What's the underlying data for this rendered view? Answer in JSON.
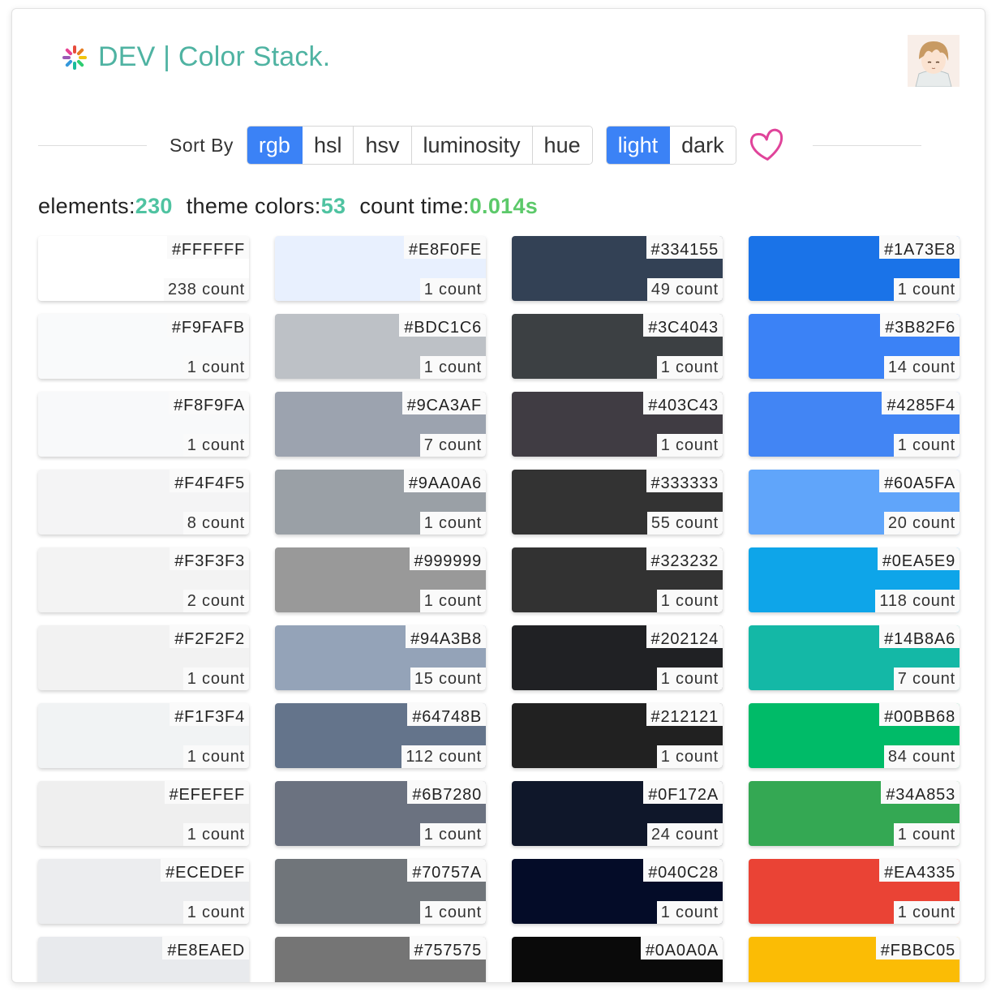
{
  "header": {
    "title": "DEV | Color Stack.",
    "logo_icon": "pinwheel-logo-icon",
    "avatar_icon": "anime-avatar-icon"
  },
  "toolbar": {
    "sort_label": "Sort By",
    "sort_options": [
      "rgb",
      "hsl",
      "hsv",
      "luminosity",
      "hue"
    ],
    "sort_selected": "rgb",
    "theme_options": [
      "light",
      "dark"
    ],
    "theme_selected": "light",
    "like_icon": "heart-icon",
    "accent_color": "#3b82f6"
  },
  "stats": {
    "elements_label": "elements:",
    "elements_value": "230",
    "theme_colors_label": "theme colors:",
    "theme_colors_value": "53",
    "count_time_label": "count time:",
    "count_time_value": "0.014s"
  },
  "columns": [
    [
      {
        "hex": "#FFFFFF",
        "count": "238 count"
      },
      {
        "hex": "#F9FAFB",
        "count": "1 count"
      },
      {
        "hex": "#F8F9FA",
        "count": "1 count"
      },
      {
        "hex": "#F4F4F5",
        "count": "8 count"
      },
      {
        "hex": "#F3F3F3",
        "count": "2 count"
      },
      {
        "hex": "#F2F2F2",
        "count": "1 count"
      },
      {
        "hex": "#F1F3F4",
        "count": "1 count"
      },
      {
        "hex": "#EFEFEF",
        "count": "1 count"
      },
      {
        "hex": "#ECEDEF",
        "count": "1 count"
      },
      {
        "hex": "#E8EAED",
        "count": ""
      }
    ],
    [
      {
        "hex": "#E8F0FE",
        "count": "1 count"
      },
      {
        "hex": "#BDC1C6",
        "count": "1 count"
      },
      {
        "hex": "#9CA3AF",
        "count": "7 count"
      },
      {
        "hex": "#9AA0A6",
        "count": "1 count"
      },
      {
        "hex": "#999999",
        "count": "1 count"
      },
      {
        "hex": "#94A3B8",
        "count": "15 count"
      },
      {
        "hex": "#64748B",
        "count": "112 count"
      },
      {
        "hex": "#6B7280",
        "count": "1 count"
      },
      {
        "hex": "#70757A",
        "count": "1 count"
      },
      {
        "hex": "#757575",
        "count": ""
      }
    ],
    [
      {
        "hex": "#334155",
        "count": "49 count"
      },
      {
        "hex": "#3C4043",
        "count": "1 count"
      },
      {
        "hex": "#403C43",
        "count": "1 count"
      },
      {
        "hex": "#333333",
        "count": "55 count"
      },
      {
        "hex": "#323232",
        "count": "1 count"
      },
      {
        "hex": "#202124",
        "count": "1 count"
      },
      {
        "hex": "#212121",
        "count": "1 count"
      },
      {
        "hex": "#0F172A",
        "count": "24 count"
      },
      {
        "hex": "#040C28",
        "count": "1 count"
      },
      {
        "hex": "#0A0A0A",
        "count": ""
      }
    ],
    [
      {
        "hex": "#1A73E8",
        "count": "1 count"
      },
      {
        "hex": "#3B82F6",
        "count": "14 count"
      },
      {
        "hex": "#4285F4",
        "count": "1 count"
      },
      {
        "hex": "#60A5FA",
        "count": "20 count"
      },
      {
        "hex": "#0EA5E9",
        "count": "118 count"
      },
      {
        "hex": "#14B8A6",
        "count": "7 count"
      },
      {
        "hex": "#00BB68",
        "count": "84 count"
      },
      {
        "hex": "#34A853",
        "count": "1 count"
      },
      {
        "hex": "#EA4335",
        "count": "1 count"
      },
      {
        "hex": "#FBBC05",
        "count": ""
      }
    ]
  ]
}
